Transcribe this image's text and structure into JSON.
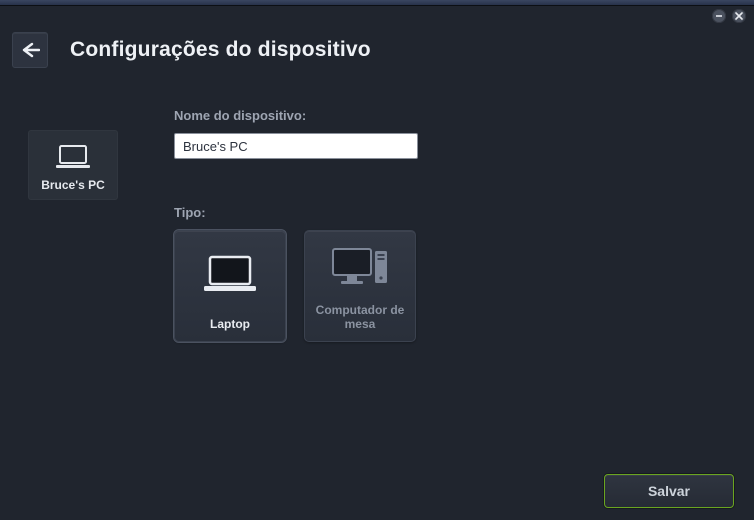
{
  "header": {
    "title": "Configurações do dispositivo"
  },
  "sidebar": {
    "device_label": "Bruce's PC"
  },
  "form": {
    "name_label": "Nome do dispositivo:",
    "name_value": "Bruce's PC",
    "type_label": "Tipo:",
    "types": {
      "laptop": "Laptop",
      "desktop": "Computador de mesa"
    }
  },
  "footer": {
    "save_label": "Salvar"
  }
}
